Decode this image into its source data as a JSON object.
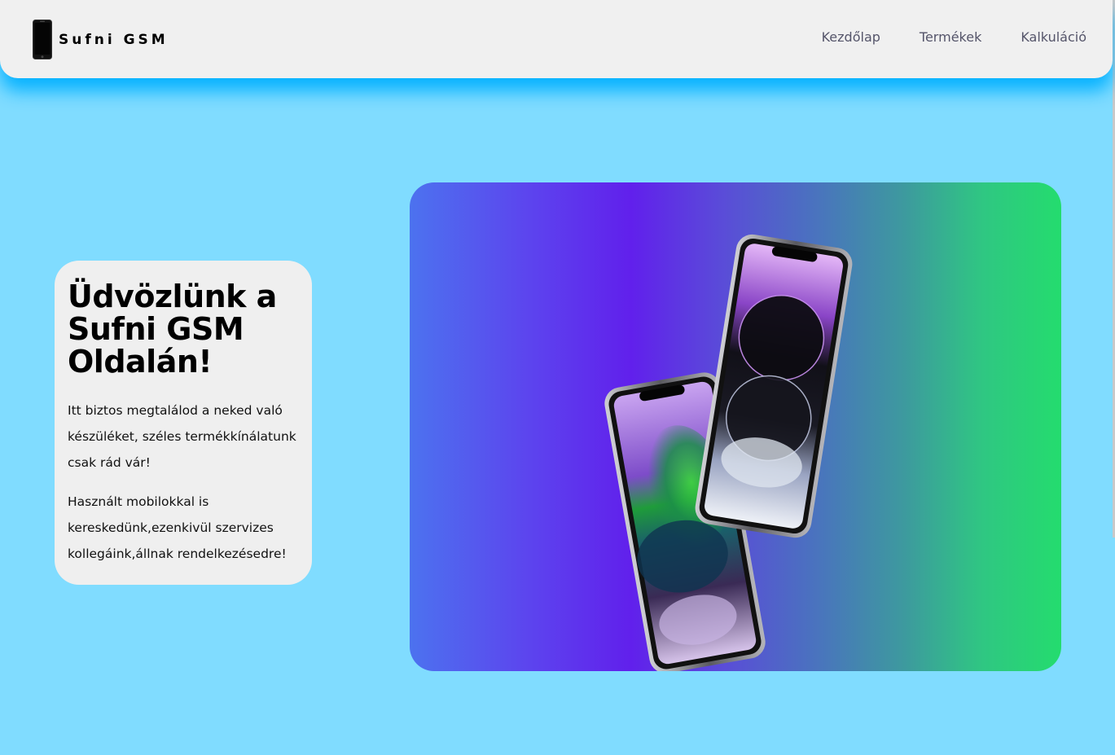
{
  "header": {
    "brand": "Sufni GSM",
    "nav": [
      {
        "label": "Kezdőlap"
      },
      {
        "label": "Termékek"
      },
      {
        "label": "Kalkuláció"
      }
    ]
  },
  "welcome": {
    "title": "Üdvözlünk a Sufni GSM Oldalán!",
    "paragraph_1": "Itt biztos megtalálod a neked való készüléket, széles termékkínálatunk csak rád vár!",
    "paragraph_2": "Használt mobilokkal is kereskedünk,ezenkivül szervizes kollegáink,állnak rendelkezésedre!"
  },
  "hero": {
    "image_name": "two-smartphones-image"
  },
  "colors": {
    "page_background": "#80dcff",
    "header_background": "#f0f0f0",
    "header_glow": "#00b0ff",
    "card_background": "#efefef",
    "gradient_left": "#4c72ef",
    "gradient_mid": "#6120ec",
    "gradient_right": "#24dc6e"
  }
}
